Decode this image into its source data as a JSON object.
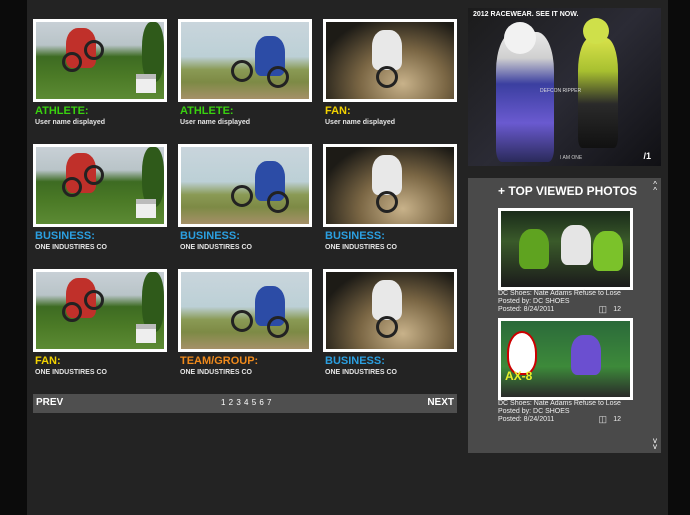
{
  "grid": [
    {
      "category": "ATHLETE:",
      "color": "#39d10f",
      "subtitle": "User name displayed",
      "photo": "forest"
    },
    {
      "category": "ATHLETE:",
      "color": "#39d10f",
      "subtitle": "User name displayed",
      "photo": "sky"
    },
    {
      "category": "FAN:",
      "color": "#f2d200",
      "subtitle": "User name displayed",
      "photo": "dirt"
    },
    {
      "category": "BUSINESS:",
      "color": "#2b9fe0",
      "subtitle": "ONE INDUSTIRES CO",
      "photo": "forest"
    },
    {
      "category": "BUSINESS:",
      "color": "#2b9fe0",
      "subtitle": "ONE INDUSTIRES CO",
      "photo": "sky"
    },
    {
      "category": "BUSINESS:",
      "color": "#2b9fe0",
      "subtitle": "ONE INDUSTIRES CO",
      "photo": "dirt"
    },
    {
      "category": "FAN:",
      "color": "#f2d200",
      "subtitle": "ONE INDUSTIRES CO",
      "photo": "forest"
    },
    {
      "category": "TEAM/GROUP:",
      "color": "#f08a1c",
      "subtitle": "ONE INDUSTIRES CO",
      "photo": "sky"
    },
    {
      "category": "BUSINESS:",
      "color": "#2b9fe0",
      "subtitle": "ONE INDUSTIRES CO",
      "photo": "dirt"
    }
  ],
  "pager": {
    "prev": "PREV",
    "next": "NEXT",
    "pages": "1 2 3 4 5 6 7"
  },
  "ad": {
    "headline": "2012 RACEWEAR. SEE IT NOW.",
    "brand": "I AM ONE",
    "tag": "DEFCON RIPPER"
  },
  "top_viewed": {
    "title": "+ TOP VIEWED PHOTOS",
    "items": [
      {
        "title": "DC Shoes: Nate Adams Refuse to Lose",
        "posted_by": "Posted by: DC SHOES",
        "posted": "Posted: 8/24/2011",
        "views": "12"
      },
      {
        "title": "DC Shoes: Nate Adams Refuse to Lose",
        "posted_by": "Posted by: DC SHOES",
        "posted": "Posted: 8/24/2011",
        "views": "12"
      }
    ]
  }
}
